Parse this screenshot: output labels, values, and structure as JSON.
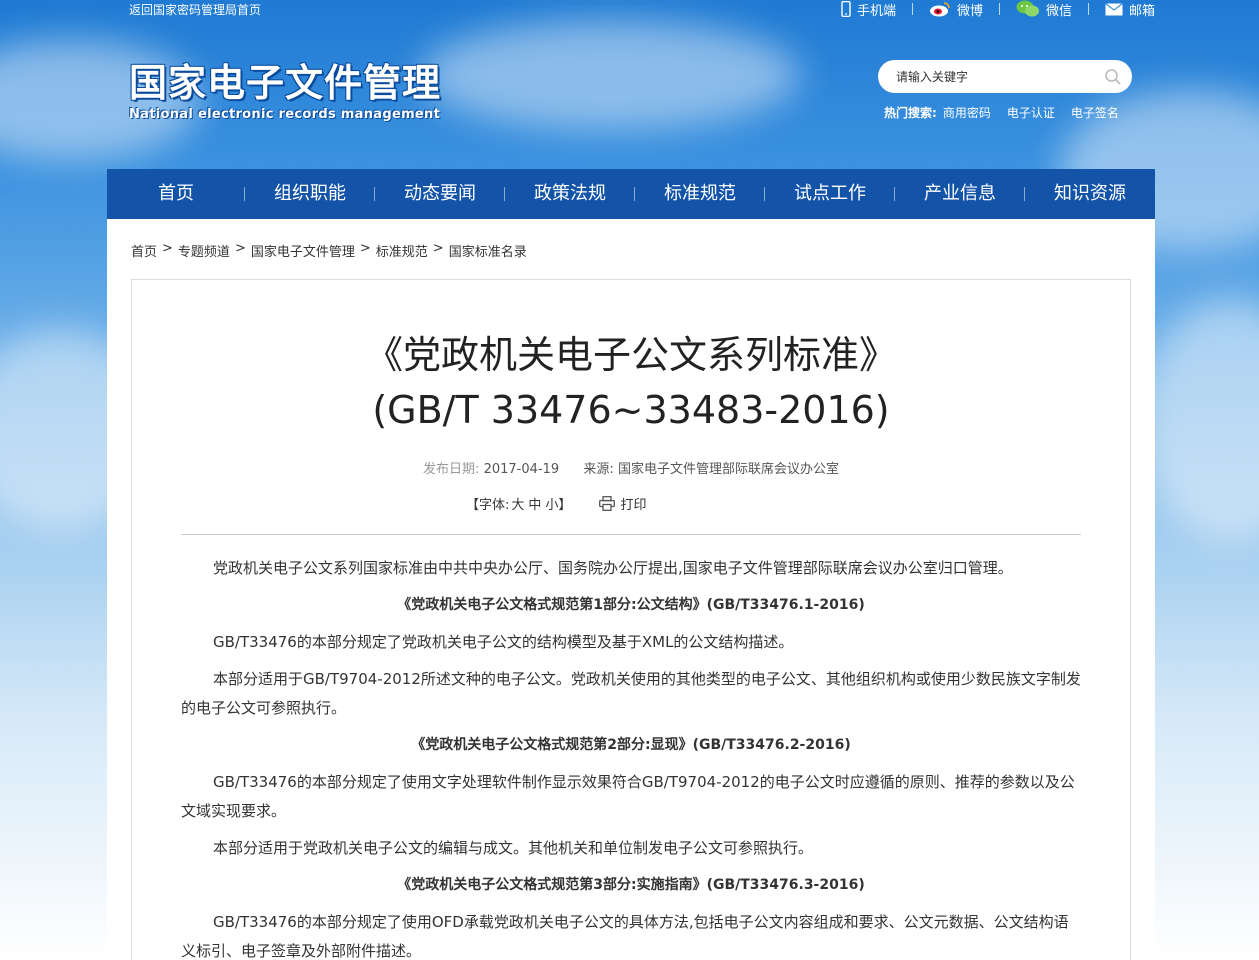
{
  "topbar": {
    "back_link": "返回国家密码管理局首页",
    "links": [
      {
        "label": "手机端",
        "icon": "mobile-icon"
      },
      {
        "label": "微博",
        "icon": "weibo-icon"
      },
      {
        "label": "微信",
        "icon": "wechat-icon"
      },
      {
        "label": "邮箱",
        "icon": "mail-icon"
      }
    ]
  },
  "logo": {
    "cn": "国家电子文件管理",
    "en": "National electronic records management"
  },
  "search": {
    "placeholder": "请输入关键字",
    "hot_label": "热门搜索:",
    "hot_terms": [
      "商用密码",
      "电子认证",
      "电子签名"
    ]
  },
  "nav": {
    "items": [
      "首页",
      "组织职能",
      "动态要闻",
      "政策法规",
      "标准规范",
      "试点工作",
      "产业信息",
      "知识资源"
    ]
  },
  "breadcrumb": [
    "首页",
    "专题频道",
    "国家电子文件管理",
    "标准规范",
    "国家标准名录"
  ],
  "article": {
    "title_line1": "《党政机关电子公文系列标准》",
    "title_line2": "(GB/T 33476~33483-2016)",
    "date_label": "发布日期:",
    "date": "2017-04-19",
    "source_label": "来源:",
    "source": "国家电子文件管理部际联席会议办公室",
    "font_label": "【字体:",
    "font_large": "大",
    "font_medium": "中",
    "font_small": "小】",
    "print": "打印",
    "paragraphs": [
      {
        "type": "p",
        "text": "党政机关电子公文系列国家标准由中共中央办公厅、国务院办公厅提出,国家电子文件管理部际联席会议办公室归口管理。"
      },
      {
        "type": "h",
        "text": "《党政机关电子公文格式规范第1部分:公文结构》(GB/T33476.1-2016)"
      },
      {
        "type": "p",
        "text": "GB/T33476的本部分规定了党政机关电子公文的结构模型及基于XML的公文结构描述。"
      },
      {
        "type": "p",
        "text": "本部分适用于GB/T9704-2012所述文种的电子公文。党政机关使用的其他类型的电子公文、其他组织机构或使用少数民族文字制发的电子公文可参照执行。"
      },
      {
        "type": "h",
        "text": "《党政机关电子公文格式规范第2部分:显现》(GB/T33476.2-2016)"
      },
      {
        "type": "p",
        "text": "GB/T33476的本部分规定了使用文字处理软件制作显示效果符合GB/T9704-2012的电子公文时应遵循的原则、推荐的参数以及公文域实现要求。"
      },
      {
        "type": "p",
        "text": "本部分适用于党政机关电子公文的编辑与成文。其他机关和单位制发电子公文可参照执行。"
      },
      {
        "type": "h",
        "text": "《党政机关电子公文格式规范第3部分:实施指南》(GB/T33476.3-2016)"
      },
      {
        "type": "p",
        "text": "GB/T33476的本部分规定了使用OFD承载党政机关电子公文的具体方法,包括电子公文内容组成和要求、公文元数据、公文结构语义标引、电子签章及外部附件描述。"
      }
    ]
  }
}
